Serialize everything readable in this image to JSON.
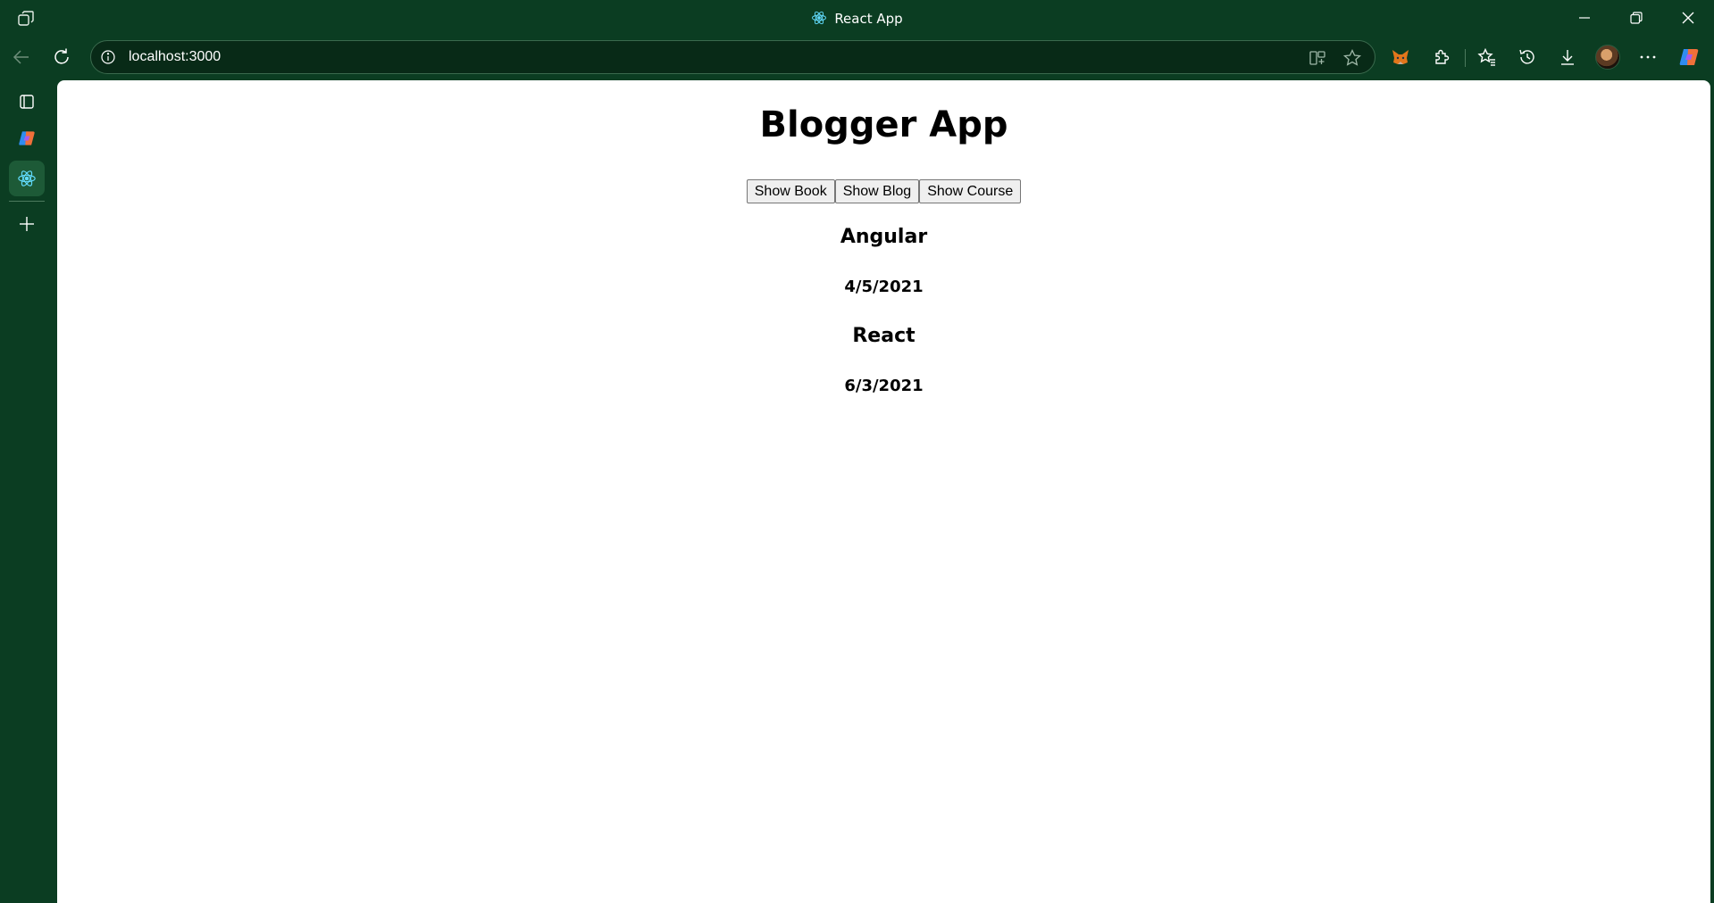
{
  "window": {
    "tab_title": "React App"
  },
  "toolbar": {
    "url": "localhost:3000"
  },
  "page": {
    "heading": "Blogger App",
    "buttons": [
      {
        "label": "Show Book"
      },
      {
        "label": "Show Blog"
      },
      {
        "label": "Show Course"
      }
    ],
    "posts": [
      {
        "title": "Angular",
        "date": "4/5/2021"
      },
      {
        "title": "React",
        "date": "6/3/2021"
      }
    ]
  },
  "colors": {
    "browser_chrome": "#0b3d22",
    "page_background": "#ffffff",
    "active_tab": "#1d5a37"
  }
}
